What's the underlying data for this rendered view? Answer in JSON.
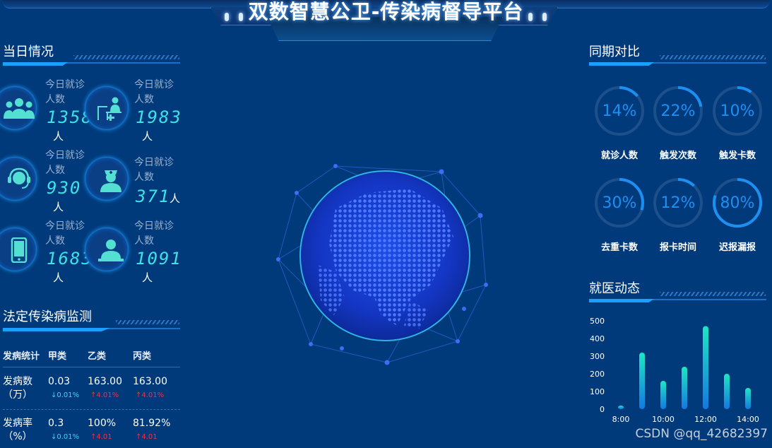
{
  "header": {
    "title": "双数智慧公卫-传染病督导平台"
  },
  "today": {
    "title": "当日情况",
    "items": [
      {
        "icon": "users-icon",
        "label": "今日就诊人数",
        "value": "1358",
        "unit": "人"
      },
      {
        "icon": "doctor-teaching-icon",
        "label": "今日就诊人数",
        "value": "1983",
        "unit": "人"
      },
      {
        "icon": "headset-icon",
        "label": "今日就诊人数",
        "value": "930",
        "unit": "人"
      },
      {
        "icon": "nurse-icon",
        "label": "今日就诊人数",
        "value": "371",
        "unit": "人"
      },
      {
        "icon": "phone-icon",
        "label": "今日就诊人数",
        "value": "1683",
        "unit": "人"
      },
      {
        "icon": "computer-user-icon",
        "label": "今日就诊人数",
        "value": "1091",
        "unit": "人"
      }
    ]
  },
  "disease": {
    "title": "法定传染病监测",
    "headers": [
      "发病统计",
      "甲类",
      "乙类",
      "丙类"
    ],
    "rows": [
      {
        "label1": "发病数",
        "label2": "（万）",
        "values": [
          "0.03",
          "163.00",
          "163.00"
        ],
        "changes": [
          {
            "text": "↓0.01%",
            "dir": "down"
          },
          {
            "text": "↑4.01%",
            "dir": "up"
          },
          {
            "text": "↑4.01%",
            "dir": "up"
          }
        ]
      },
      {
        "label1": "发病率",
        "label2": "（%）",
        "values": [
          "0.3",
          "100%",
          "81.92%"
        ],
        "changes": [
          {
            "text": "↓0.01%",
            "dir": "down"
          },
          {
            "text": "↑4.01",
            "dir": "up"
          },
          {
            "text": "↑4.01",
            "dir": "up"
          }
        ]
      }
    ]
  },
  "compare": {
    "title": "同期对比",
    "rings": [
      {
        "value": "14%",
        "percent": 14,
        "label": "就诊人数"
      },
      {
        "value": "22%",
        "percent": 22,
        "label": "触发次数"
      },
      {
        "value": "10%",
        "percent": 10,
        "label": "触发卡数"
      },
      {
        "value": "30%",
        "percent": 30,
        "label": "去重卡数"
      },
      {
        "value": "12%",
        "percent": 12,
        "label": "报卡时间"
      },
      {
        "value": "80%",
        "percent": 80,
        "label": "迟报漏报"
      }
    ]
  },
  "dynamics": {
    "title": "就医动态",
    "chart_data": {
      "type": "bar",
      "x": [
        "8:00",
        "9:00",
        "10:00",
        "11:00",
        "12:00",
        "13:00",
        "14:00"
      ],
      "x_tick_labels": [
        "8:00",
        "10:00",
        "12:00",
        "14:00"
      ],
      "values": [
        20,
        320,
        160,
        240,
        470,
        200,
        120
      ],
      "ylim": [
        0,
        500
      ],
      "y_ticks": [
        0,
        100,
        200,
        300,
        400,
        500
      ],
      "grid": false,
      "colors": [
        "#1ee6c4",
        "#1478e0"
      ]
    }
  },
  "watermark": "CSDN @qq_42682397"
}
